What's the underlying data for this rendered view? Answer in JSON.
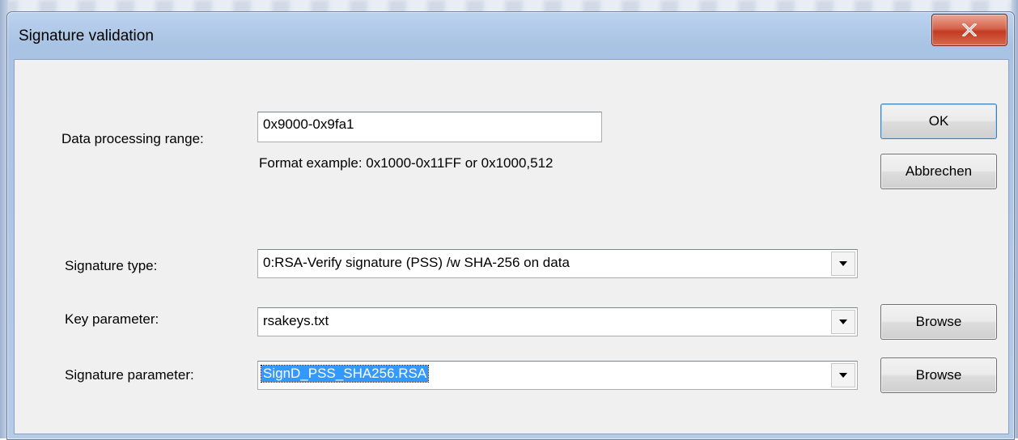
{
  "window": {
    "title": "Signature validation"
  },
  "fields": {
    "data_range_label": "Data processing range:",
    "data_range_value": "0x9000-0x9fa1",
    "format_hint": "Format example: 0x1000-0x11FF or 0x1000,512",
    "signature_type_label": "Signature type:",
    "signature_type_value": "0:RSA-Verify signature (PSS) /w SHA-256 on data",
    "key_parameter_label": "Key parameter:",
    "key_parameter_value": "rsakeys.txt",
    "signature_parameter_label": "Signature parameter:",
    "signature_parameter_value": "SignD_PSS_SHA256.RSA"
  },
  "buttons": {
    "ok": "OK",
    "cancel": "Abbrechen",
    "browse_key": "Browse",
    "browse_signature": "Browse"
  },
  "icons": {
    "close": "close-icon",
    "dropdown": "chevron-down-icon"
  },
  "colors": {
    "selection": "#3399ff",
    "close_button": "#c23b22",
    "dialog_face": "#f0f0f0"
  }
}
